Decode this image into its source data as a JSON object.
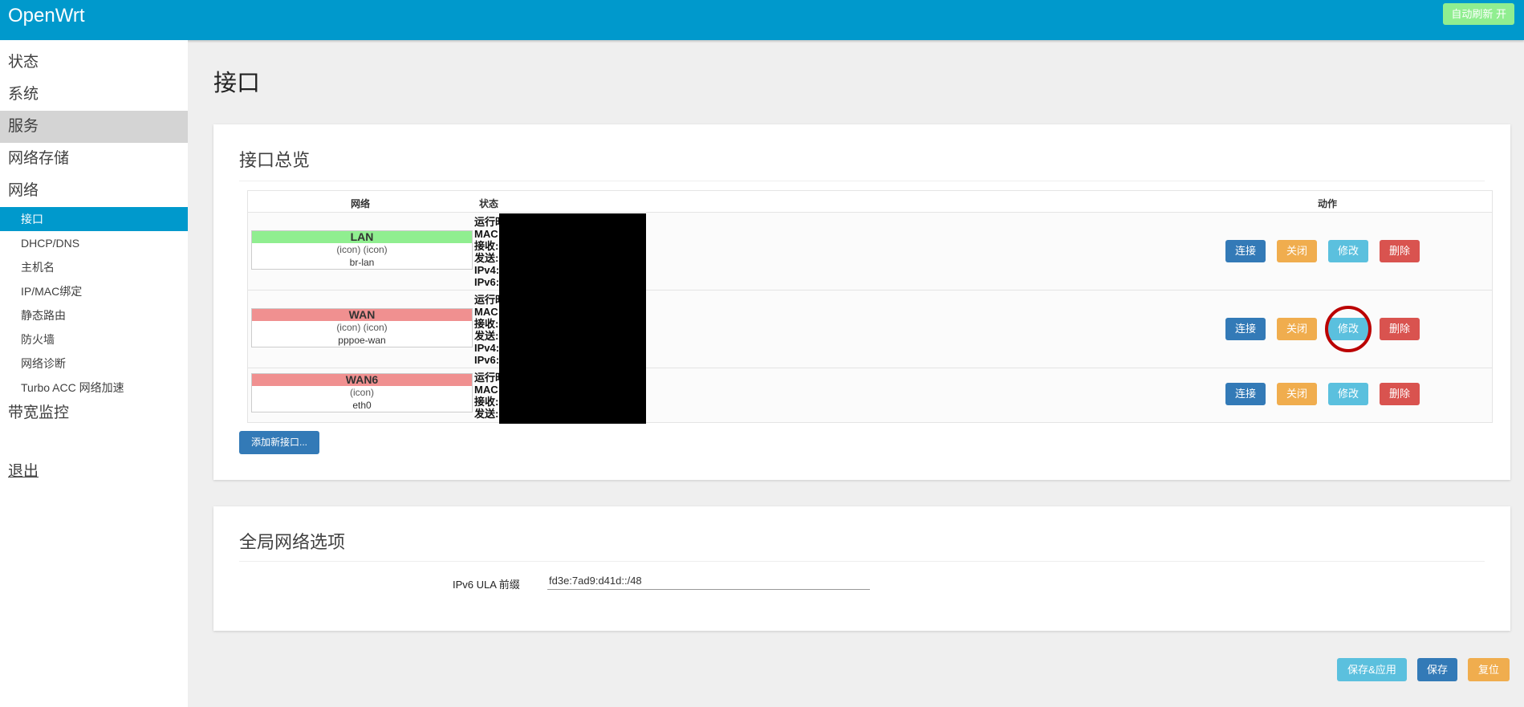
{
  "header": {
    "brand": "OpenWrt",
    "auto_refresh": "自动刷新 开"
  },
  "sidebar": {
    "categories": {
      "status": "状态",
      "system": "系统",
      "services": "服务",
      "nas": "网络存储",
      "network": "网络",
      "bandwidth": "带宽监控",
      "logout": "退出"
    },
    "network_items": [
      "接口",
      "DHCP/DNS",
      "主机名",
      "IP/MAC绑定",
      "静态路由",
      "防火墙",
      "网络诊断",
      "Turbo ACC 网络加速"
    ]
  },
  "page": {
    "title": "接口"
  },
  "overview": {
    "title": "接口总览",
    "col_network": "网络",
    "col_status": "状态",
    "col_actions": "动作",
    "interfaces": [
      {
        "name": "LAN",
        "color": "#90ee90",
        "icons": "(icon) (icon)",
        "device": "br-lan",
        "status_lines": [
          "运行时间:",
          "MAC 地址",
          "接收:",
          "发送:",
          "IPv4:",
          "IPv6:"
        ]
      },
      {
        "name": "WAN",
        "color": "#f09090",
        "icons": "(icon) (icon)",
        "device": "pppoe-wan",
        "status_lines": [
          "运行时间:",
          "MAC 地址",
          "接收:",
          "发送:",
          "IPv4:",
          "IPv6:"
        ]
      },
      {
        "name": "WAN6",
        "color": "#f09090",
        "icons": "(icon)",
        "device": "eth0",
        "status_lines": [
          "运行时间:",
          "MAC 地址",
          "接收:",
          "发送:"
        ]
      }
    ],
    "actions": {
      "connect": "连接",
      "stop": "关闭",
      "edit": "修改",
      "delete": "删除"
    },
    "add_button": "添加新接口..."
  },
  "global": {
    "title": "全局网络选项",
    "ula_label": "IPv6 ULA 前缀",
    "ula_value": "fd3e:7ad9:d41d::/48"
  },
  "footer": {
    "save_apply": "保存&应用",
    "save": "保存",
    "reset": "复位"
  }
}
